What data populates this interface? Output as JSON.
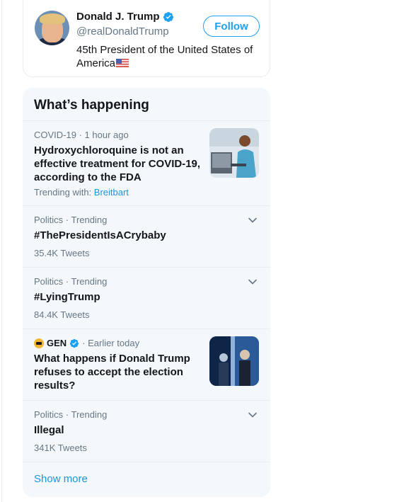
{
  "profile": {
    "name": "Donald J. Trump",
    "handle": "@realDonaldTrump",
    "bio": "45th President of the United States of America",
    "follow_label": "Follow"
  },
  "trends": {
    "title": "What’s happening",
    "items": [
      {
        "meta_category": "COVID-19",
        "meta_sep": " · ",
        "meta_time": "1 hour ago",
        "headline": "Hydroxychloroquine is not an effective treatment for COVID-19, according to the FDA",
        "trending_with_label": "Trending with: ",
        "trending_with_link": "Breitbart"
      },
      {
        "meta": "Politics · Trending",
        "headline": "#ThePresidentIsACrybaby",
        "count": "35.4K Tweets"
      },
      {
        "meta": "Politics · Trending",
        "headline": "#LyingTrump",
        "count": "84.4K Tweets"
      },
      {
        "source": "GEN",
        "meta_time": "· Earlier today",
        "headline": "What happens if Donald Trump refuses to accept the election results?"
      },
      {
        "meta": "Politics · Trending",
        "headline": "Illegal",
        "count": "341K Tweets"
      }
    ],
    "show_more": "Show more"
  },
  "colors": {
    "accent": "#1da1f2",
    "link": "#1b95e0",
    "panel_bg": "#f5f8fa",
    "secondary_text": "#657786"
  }
}
